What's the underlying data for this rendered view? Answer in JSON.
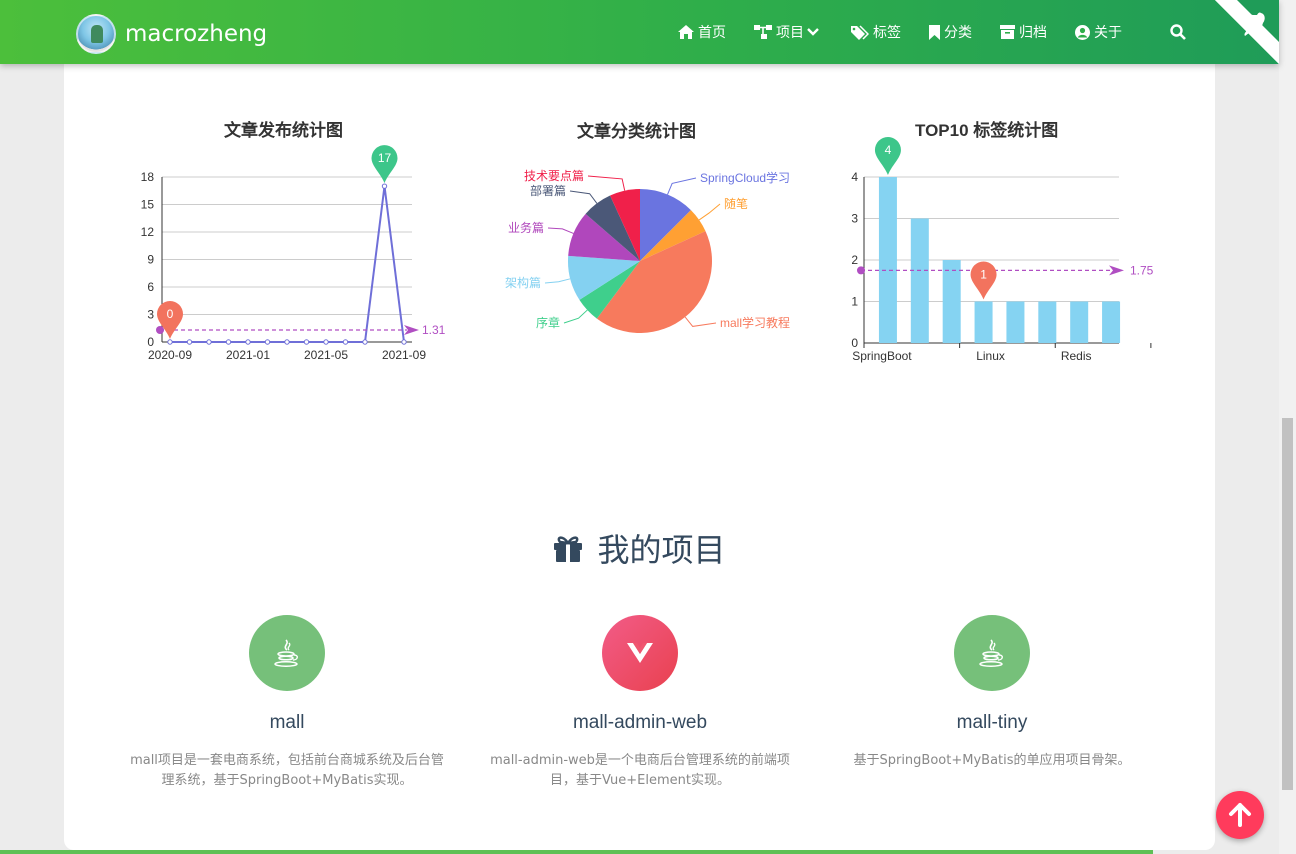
{
  "brand": {
    "name": "macrozheng"
  },
  "nav": {
    "items": [
      {
        "label": "首页",
        "icon": "home-icon"
      },
      {
        "label": "项目",
        "icon": "sitemap-icon"
      },
      {
        "label": "标签",
        "icon": "tags-icon"
      },
      {
        "label": "分类",
        "icon": "bookmark-icon"
      },
      {
        "label": "归档",
        "icon": "archive-icon"
      },
      {
        "label": "关于",
        "icon": "user-circle-icon"
      }
    ],
    "search_icon": "search-icon"
  },
  "chart_data": [
    {
      "type": "line",
      "title": "文章发布统计图",
      "x_ticks": [
        "2020-09",
        "2021-01",
        "2021-05",
        "2021-09"
      ],
      "y_ticks": [
        0,
        3,
        6,
        9,
        12,
        15,
        18
      ],
      "ylim": [
        0,
        18
      ],
      "series": [
        {
          "values": [
            0,
            0,
            0,
            0,
            0,
            0,
            0,
            0,
            0,
            0,
            0,
            17,
            0
          ]
        }
      ],
      "markpoint_min": "0",
      "markpoint_max": "17",
      "average_label": "1.31",
      "colors": {
        "line": "#6f6fd8",
        "min": "#f2735e",
        "max": "#3dc68a",
        "avg": "#b04ec2"
      }
    },
    {
      "type": "pie",
      "title": "文章分类统计图",
      "slices": [
        {
          "name": "SpringCloud学习教程",
          "value": 11,
          "color": "#6a74e0"
        },
        {
          "name": "随笔",
          "value": 5,
          "color": "#ffa033"
        },
        {
          "name": "mall学习教程",
          "value": 37,
          "color": "#f77a5d"
        },
        {
          "name": "序章",
          "value": 5,
          "color": "#3fcf8c"
        },
        {
          "name": "架构篇",
          "value": 9,
          "color": "#84d1f1"
        },
        {
          "name": "业务篇",
          "value": 9,
          "color": "#b047bc"
        },
        {
          "name": "部署篇",
          "value": 6,
          "color": "#4b5878"
        },
        {
          "name": "技术要点篇",
          "value": 6,
          "color": "#f0204a"
        }
      ],
      "visible_label_texts": [
        "SpringCloud学习",
        "随笔",
        "mall学习教程",
        "序章",
        "架构篇",
        "业务篇",
        "部署篇",
        "技术要点篇"
      ]
    },
    {
      "type": "bar",
      "title": "TOP10 标签统计图",
      "categories": [
        "SpringBoot",
        "",
        "",
        "Linux",
        "",
        "",
        "Redis",
        ""
      ],
      "x_ticks": [
        "SpringBoot",
        "Linux",
        "Redis"
      ],
      "values": [
        4,
        3,
        2,
        1,
        1,
        1,
        1,
        1
      ],
      "y_ticks": [
        0,
        1,
        2,
        3,
        4
      ],
      "ylim": [
        0,
        4
      ],
      "markpoint_max": "4",
      "markpoint_min": "1",
      "average_label": "1.75",
      "colors": {
        "bar": "#85d3f2",
        "min": "#f2735e",
        "max": "#3dc68a",
        "avg": "#b04ec2"
      }
    }
  ],
  "projects": {
    "title": "我的项目",
    "items": [
      {
        "name": "mall",
        "desc": "mall项目是一套电商系统，包括前台商城系统及后台管理系统，基于SpringBoot+MyBatis实现。",
        "icon": "java-icon",
        "color": "#6fbf73"
      },
      {
        "name": "mall-admin-web",
        "desc": "mall-admin-web是一个电商后台管理系统的前端项目，基于Vue+Element实现。",
        "icon": "vue-icon",
        "color": "#ee4f6e"
      },
      {
        "name": "mall-tiny",
        "desc": "基于SpringBoot+MyBatis的单应用项目骨架。",
        "icon": "java-icon",
        "color": "#6fbf73"
      }
    ]
  }
}
